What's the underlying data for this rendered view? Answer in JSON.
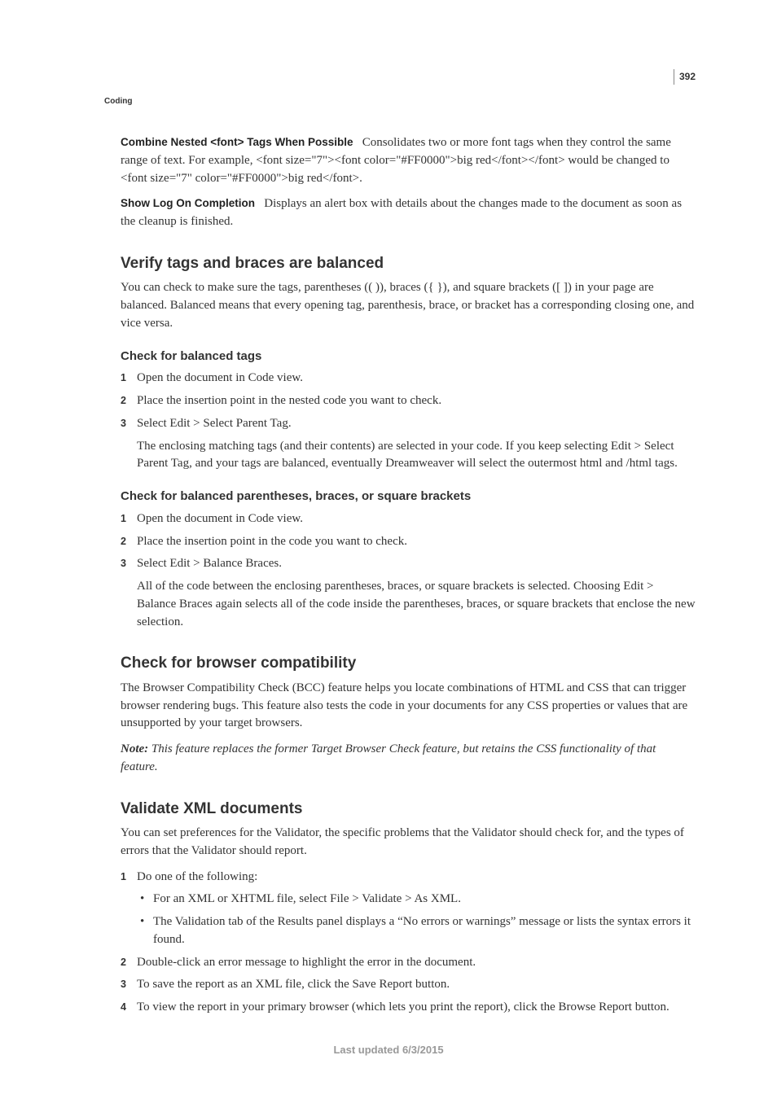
{
  "header": {
    "section_label": "Coding",
    "page_number": "392"
  },
  "intro": {
    "combine_title": "Combine Nested <font> Tags When Possible",
    "combine_body": "Consolidates two or more font tags when they control the same range of text. For example, <font size=\"7\"><font color=\"#FF0000\">big red</font></font> would be changed to <font size=\"7\" color=\"#FF0000\">big red</font>.",
    "showlog_title": "Show Log On Completion",
    "showlog_body": "Displays an alert box with details about the changes made to the document as soon as the cleanup is finished."
  },
  "verify": {
    "heading": "Verify tags and braces are balanced",
    "body": "You can check to make sure the tags, parentheses (( )), braces ({ }), and square brackets ([ ]) in your page are balanced. Balanced means that every opening tag, parenthesis, brace, or bracket has a corresponding closing one, and vice versa.",
    "tags": {
      "heading": "Check for balanced tags",
      "steps": [
        "Open the document in Code view.",
        "Place the insertion point in the nested code you want to check.",
        "Select Edit > Select Parent Tag."
      ],
      "after": "The enclosing matching tags (and their contents) are selected in your code. If you keep selecting Edit > Select Parent Tag, and your tags are balanced, eventually Dreamweaver will select the outermost html and /html tags."
    },
    "braces": {
      "heading": "Check for balanced parentheses, braces, or square brackets",
      "steps": [
        "Open the document in Code view.",
        "Place the insertion point in the code you want to check.",
        "Select Edit > Balance Braces."
      ],
      "after": "All of the code between the enclosing parentheses, braces, or square brackets is selected. Choosing Edit > Balance Braces again selects all of the code inside the parentheses, braces, or square brackets that enclose the new selection."
    }
  },
  "compat": {
    "heading": "Check for browser compatibility",
    "body": "The Browser Compatibility Check (BCC) feature helps you locate combinations of HTML and CSS that can trigger browser rendering bugs. This feature also tests the code in your documents for any CSS properties or values that are unsupported by your target browsers.",
    "note_label": "Note:",
    "note_body": "This feature replaces the former Target Browser Check feature, but retains the CSS functionality of that feature."
  },
  "validate": {
    "heading": "Validate XML documents",
    "body": "You can set preferences for the Validator, the specific problems that the Validator should check for, and the types of errors that the Validator should report.",
    "step1": "Do one of the following:",
    "step1_bullets": [
      "For an XML or XHTML file, select File > Validate > As XML.",
      "The Validation tab of the Results panel displays a “No errors or warnings” message or lists the syntax errors it found."
    ],
    "step2": "Double-click an error message to highlight the error in the document.",
    "step3": "To save the report as an XML file, click the Save Report button.",
    "step4": "To view the report in your primary browser (which lets you print the report), click the Browse Report button."
  },
  "footer": {
    "last_updated": "Last updated 6/3/2015"
  }
}
